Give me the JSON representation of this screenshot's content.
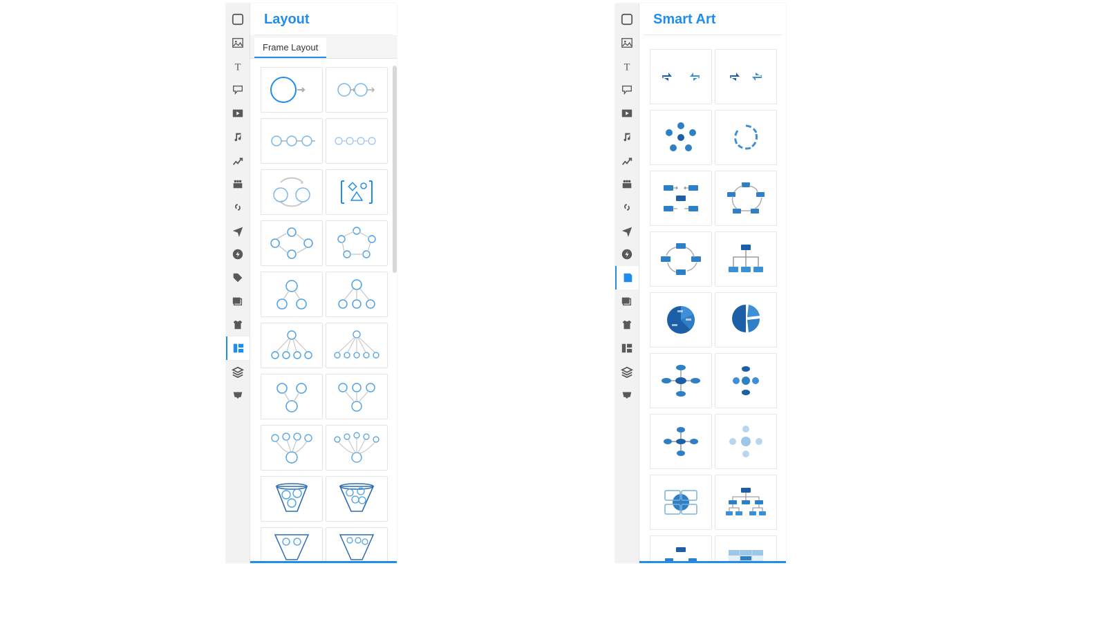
{
  "panels": {
    "layout": {
      "title": "Layout",
      "tab": "Frame Layout"
    },
    "smartart": {
      "title": "Smart Art"
    }
  },
  "toolbar": {
    "items": [
      {
        "name": "shape-icon"
      },
      {
        "name": "image-icon"
      },
      {
        "name": "text-icon"
      },
      {
        "name": "callout-icon"
      },
      {
        "name": "video-icon"
      },
      {
        "name": "music-icon"
      },
      {
        "name": "chart-icon"
      },
      {
        "name": "people-icon"
      },
      {
        "name": "link-icon"
      },
      {
        "name": "airplane-icon"
      },
      {
        "name": "flash-icon"
      },
      {
        "name": "tag-icon"
      },
      {
        "name": "gallery-icon"
      },
      {
        "name": "tshirt-icon"
      },
      {
        "name": "layout-icon"
      },
      {
        "name": "layers-icon"
      },
      {
        "name": "inbox-icon"
      }
    ]
  }
}
